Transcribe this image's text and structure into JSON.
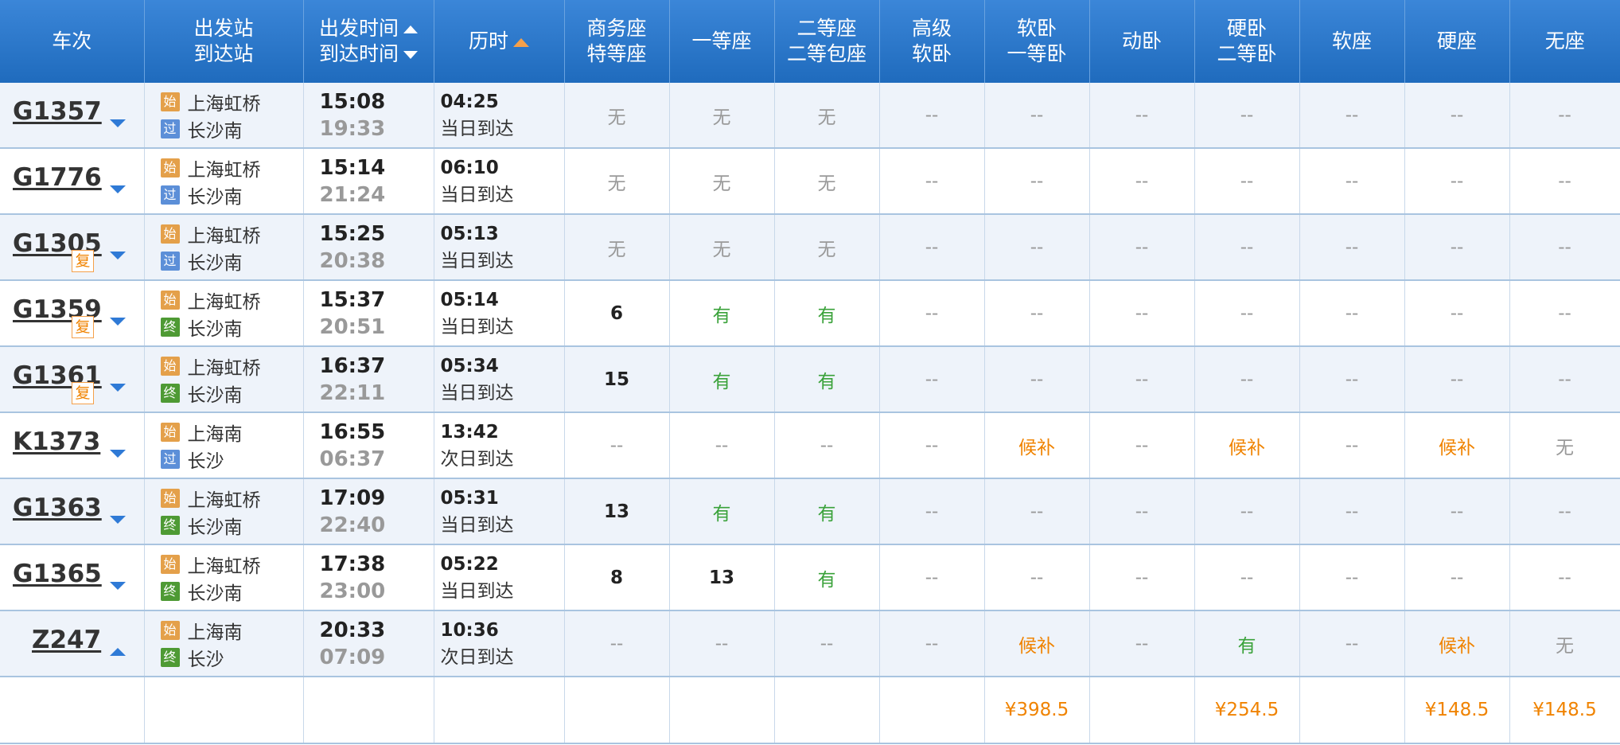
{
  "header": {
    "train": "车次",
    "stations": [
      "出发站",
      "到达站"
    ],
    "times": [
      "出发时间",
      "到达时间"
    ],
    "duration": "历时",
    "seats": [
      [
        "商务座",
        "特等座"
      ],
      [
        "一等座"
      ],
      [
        "二等座",
        "二等包座"
      ],
      [
        "高级",
        "软卧"
      ],
      [
        "软卧",
        "一等卧"
      ],
      [
        "动卧"
      ],
      [
        "硬卧",
        "二等卧"
      ],
      [
        "软座"
      ],
      [
        "硬座"
      ],
      [
        "无座"
      ]
    ]
  },
  "badge_labels": {
    "start": "始",
    "pass": "过",
    "end": "终"
  },
  "fu_label": "复",
  "rows": [
    {
      "train": "G1357",
      "fu": false,
      "toggle": "down",
      "from": "上海虹桥",
      "from_badge": "start",
      "to": "长沙南",
      "to_badge": "pass",
      "depart": "15:08",
      "arrive": "19:33",
      "duration": "04:25",
      "day": "当日到达",
      "seats": [
        [
          "无",
          "none"
        ],
        [
          "无",
          "none"
        ],
        [
          "无",
          "none"
        ],
        [
          "--",
          "dash"
        ],
        [
          "--",
          "dash"
        ],
        [
          "--",
          "dash"
        ],
        [
          "--",
          "dash"
        ],
        [
          "--",
          "dash"
        ],
        [
          "--",
          "dash"
        ],
        [
          "--",
          "dash"
        ]
      ]
    },
    {
      "train": "G1776",
      "fu": false,
      "toggle": "down",
      "from": "上海虹桥",
      "from_badge": "start",
      "to": "长沙南",
      "to_badge": "pass",
      "depart": "15:14",
      "arrive": "21:24",
      "duration": "06:10",
      "day": "当日到达",
      "seats": [
        [
          "无",
          "none"
        ],
        [
          "无",
          "none"
        ],
        [
          "无",
          "none"
        ],
        [
          "--",
          "dash"
        ],
        [
          "--",
          "dash"
        ],
        [
          "--",
          "dash"
        ],
        [
          "--",
          "dash"
        ],
        [
          "--",
          "dash"
        ],
        [
          "--",
          "dash"
        ],
        [
          "--",
          "dash"
        ]
      ]
    },
    {
      "train": "G1305",
      "fu": true,
      "toggle": "down",
      "from": "上海虹桥",
      "from_badge": "start",
      "to": "长沙南",
      "to_badge": "pass",
      "depart": "15:25",
      "arrive": "20:38",
      "duration": "05:13",
      "day": "当日到达",
      "seats": [
        [
          "无",
          "none"
        ],
        [
          "无",
          "none"
        ],
        [
          "无",
          "none"
        ],
        [
          "--",
          "dash"
        ],
        [
          "--",
          "dash"
        ],
        [
          "--",
          "dash"
        ],
        [
          "--",
          "dash"
        ],
        [
          "--",
          "dash"
        ],
        [
          "--",
          "dash"
        ],
        [
          "--",
          "dash"
        ]
      ]
    },
    {
      "train": "G1359",
      "fu": true,
      "toggle": "down",
      "from": "上海虹桥",
      "from_badge": "start",
      "to": "长沙南",
      "to_badge": "end",
      "depart": "15:37",
      "arrive": "20:51",
      "duration": "05:14",
      "day": "当日到达",
      "seats": [
        [
          "6",
          "num"
        ],
        [
          "有",
          "you"
        ],
        [
          "有",
          "you"
        ],
        [
          "--",
          "dash"
        ],
        [
          "--",
          "dash"
        ],
        [
          "--",
          "dash"
        ],
        [
          "--",
          "dash"
        ],
        [
          "--",
          "dash"
        ],
        [
          "--",
          "dash"
        ],
        [
          "--",
          "dash"
        ]
      ]
    },
    {
      "train": "G1361",
      "fu": true,
      "toggle": "down",
      "from": "上海虹桥",
      "from_badge": "start",
      "to": "长沙南",
      "to_badge": "end",
      "depart": "16:37",
      "arrive": "22:11",
      "duration": "05:34",
      "day": "当日到达",
      "seats": [
        [
          "15",
          "num"
        ],
        [
          "有",
          "you"
        ],
        [
          "有",
          "you"
        ],
        [
          "--",
          "dash"
        ],
        [
          "--",
          "dash"
        ],
        [
          "--",
          "dash"
        ],
        [
          "--",
          "dash"
        ],
        [
          "--",
          "dash"
        ],
        [
          "--",
          "dash"
        ],
        [
          "--",
          "dash"
        ]
      ]
    },
    {
      "train": "K1373",
      "fu": false,
      "toggle": "down",
      "from": "上海南",
      "from_badge": "start",
      "to": "长沙",
      "to_badge": "pass",
      "depart": "16:55",
      "arrive": "06:37",
      "duration": "13:42",
      "day": "次日到达",
      "seats": [
        [
          "--",
          "dash"
        ],
        [
          "--",
          "dash"
        ],
        [
          "--",
          "dash"
        ],
        [
          "--",
          "dash"
        ],
        [
          "候补",
          "hou"
        ],
        [
          "--",
          "dash"
        ],
        [
          "候补",
          "hou"
        ],
        [
          "--",
          "dash"
        ],
        [
          "候补",
          "hou"
        ],
        [
          "无",
          "none"
        ]
      ]
    },
    {
      "train": "G1363",
      "fu": false,
      "toggle": "down",
      "from": "上海虹桥",
      "from_badge": "start",
      "to": "长沙南",
      "to_badge": "end",
      "depart": "17:09",
      "arrive": "22:40",
      "duration": "05:31",
      "day": "当日到达",
      "seats": [
        [
          "13",
          "num"
        ],
        [
          "有",
          "you"
        ],
        [
          "有",
          "you"
        ],
        [
          "--",
          "dash"
        ],
        [
          "--",
          "dash"
        ],
        [
          "--",
          "dash"
        ],
        [
          "--",
          "dash"
        ],
        [
          "--",
          "dash"
        ],
        [
          "--",
          "dash"
        ],
        [
          "--",
          "dash"
        ]
      ]
    },
    {
      "train": "G1365",
      "fu": false,
      "toggle": "down",
      "from": "上海虹桥",
      "from_badge": "start",
      "to": "长沙南",
      "to_badge": "end",
      "depart": "17:38",
      "arrive": "23:00",
      "duration": "05:22",
      "day": "当日到达",
      "seats": [
        [
          "8",
          "num"
        ],
        [
          "13",
          "num"
        ],
        [
          "有",
          "you"
        ],
        [
          "--",
          "dash"
        ],
        [
          "--",
          "dash"
        ],
        [
          "--",
          "dash"
        ],
        [
          "--",
          "dash"
        ],
        [
          "--",
          "dash"
        ],
        [
          "--",
          "dash"
        ],
        [
          "--",
          "dash"
        ]
      ]
    },
    {
      "train": "Z247",
      "fu": false,
      "toggle": "up",
      "from": "上海南",
      "from_badge": "start",
      "to": "长沙",
      "to_badge": "end",
      "depart": "20:33",
      "arrive": "07:09",
      "duration": "10:36",
      "day": "次日到达",
      "seats": [
        [
          "--",
          "dash"
        ],
        [
          "--",
          "dash"
        ],
        [
          "--",
          "dash"
        ],
        [
          "--",
          "dash"
        ],
        [
          "候补",
          "hou"
        ],
        [
          "--",
          "dash"
        ],
        [
          "有",
          "you"
        ],
        [
          "--",
          "dash"
        ],
        [
          "候补",
          "hou"
        ],
        [
          "无",
          "none"
        ]
      ]
    }
  ],
  "prices": [
    "",
    "",
    "",
    "",
    "¥398.5",
    "",
    "¥254.5",
    "",
    "¥148.5",
    "¥148.5"
  ],
  "colors": {
    "header_blue": "#2a78cc",
    "available_green": "#3aa23a",
    "waitlist_orange": "#f08300",
    "none_gray": "#999999",
    "toggle_blue": "#2f7ad6"
  }
}
